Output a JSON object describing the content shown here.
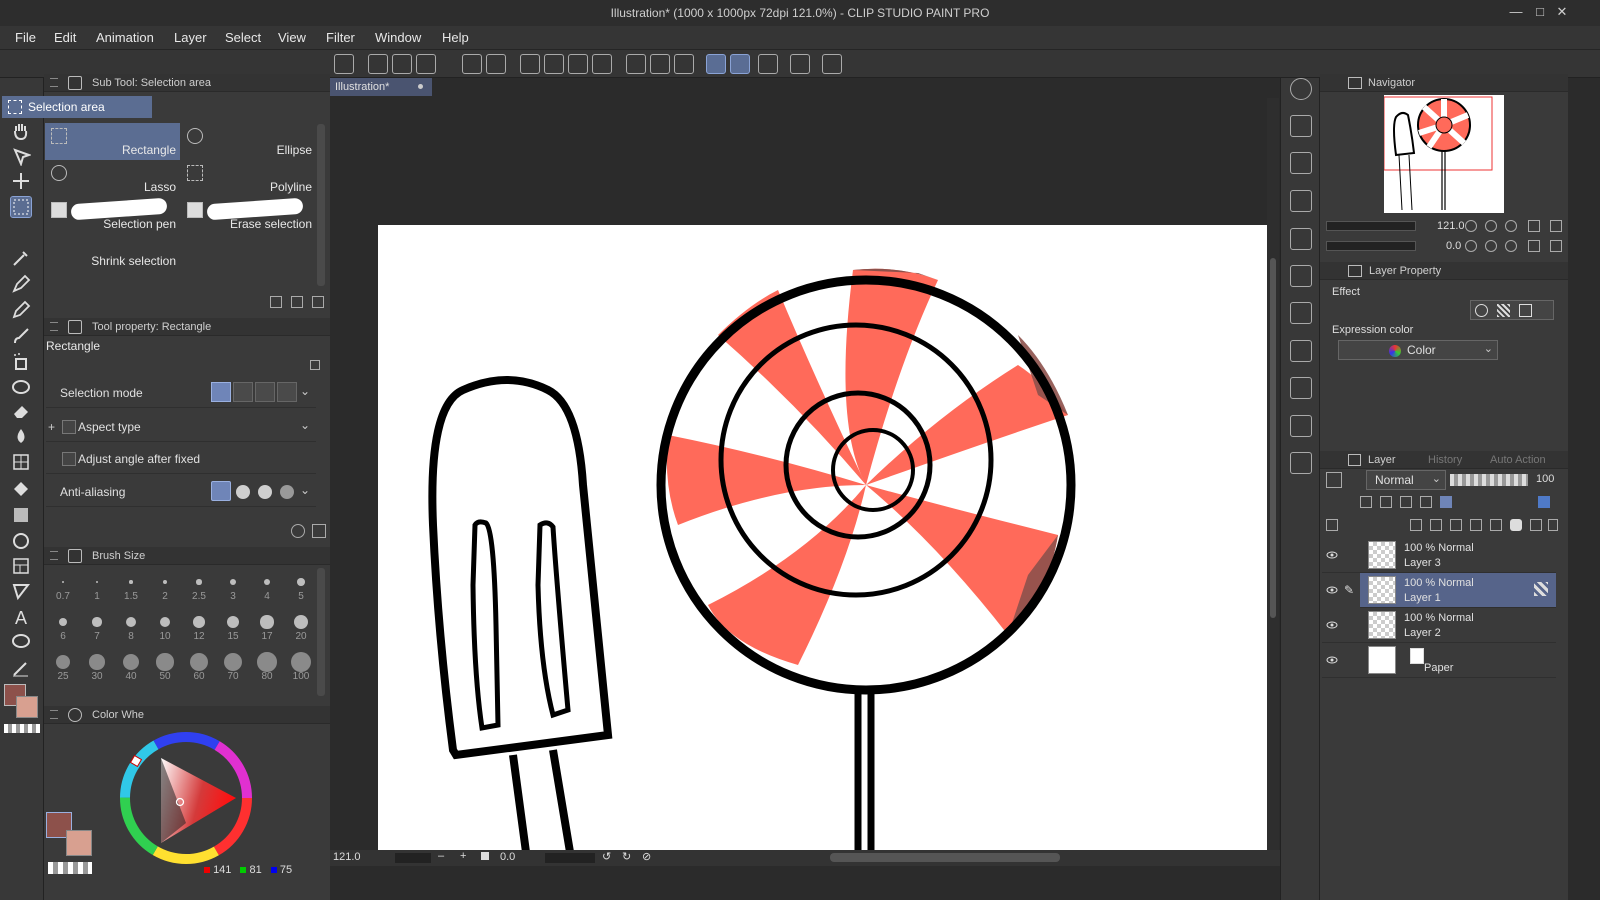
{
  "window": {
    "title": "Illustration* (1000 x 1000px 72dpi 121.0%)  - CLIP STUDIO PAINT PRO"
  },
  "menu": [
    "File",
    "Edit",
    "Animation",
    "Layer",
    "Select",
    "View",
    "Filter",
    "Window",
    "Help"
  ],
  "tooltip": "Selection area(M)",
  "subtool_panel": {
    "header": "Sub Tool: Selection area",
    "group": "Selection area",
    "items": [
      {
        "label": "Rectangle",
        "selected": true
      },
      {
        "label": "Ellipse"
      },
      {
        "label": "Lasso"
      },
      {
        "label": "Polyline"
      },
      {
        "label": "Selection pen"
      },
      {
        "label": "Erase selection"
      },
      {
        "label": "Shrink selection"
      }
    ]
  },
  "tool_property": {
    "header": "Tool property: Rectangle",
    "tool_name": "Rectangle",
    "rows": {
      "selection_mode": "Selection mode",
      "aspect_type": "Aspect type",
      "adjust_angle": "Adjust angle after fixed",
      "anti_aliasing": "Anti-aliasing"
    }
  },
  "brush_size": {
    "header": "Brush Size",
    "sizes": [
      "0.7",
      "1",
      "1.5",
      "2",
      "2.5",
      "3",
      "4",
      "5",
      "6",
      "7",
      "8",
      "10",
      "12",
      "15",
      "17",
      "20",
      "25",
      "30",
      "40",
      "50",
      "60",
      "70",
      "80",
      "100"
    ]
  },
  "color_wheel": {
    "header": "Color Whe",
    "r": "141",
    "g": "81",
    "b": "75",
    "main_color": "#8d514b",
    "sub_color": "#d8a090"
  },
  "document_tab": "Illustration*",
  "status": {
    "zoom": "121.0",
    "angle": "0.0"
  },
  "navigator": {
    "header": "Navigator",
    "zoom": "121.0",
    "angle": "0.0"
  },
  "layer_property": {
    "header": "Layer Property",
    "effect_label": "Effect",
    "expression_color_label": "Expression color",
    "expression_color_value": "Color"
  },
  "layer_panel": {
    "tabs": [
      "Layer",
      "History",
      "Auto Action"
    ],
    "blend_mode": "Normal",
    "opacity": "100",
    "layers": [
      {
        "line1": "100 % Normal",
        "line2": "Layer 3",
        "selected": false
      },
      {
        "line1": "100 % Normal",
        "line2": "Layer 1",
        "selected": true
      },
      {
        "line1": "100 % Normal",
        "line2": "Layer 2",
        "selected": false
      },
      {
        "line1": "",
        "line2": "Paper",
        "selected": false
      }
    ]
  },
  "colors": {
    "accent": "#5b6d92",
    "candy_red": "#ff6a5a",
    "candy_dark_red": "#8d514b"
  }
}
